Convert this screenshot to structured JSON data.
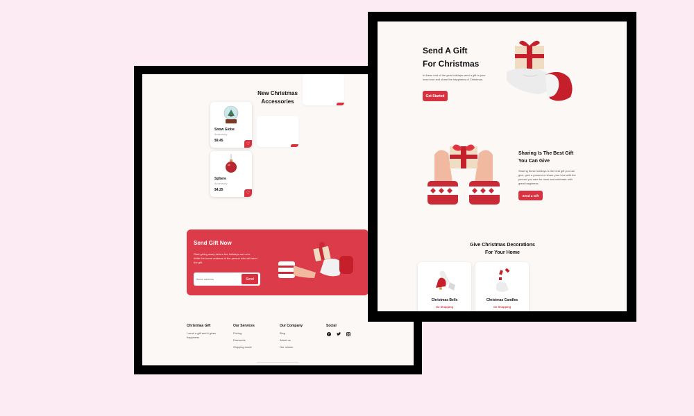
{
  "colors": {
    "background": "#fcebf3",
    "accent": "#d83240",
    "promo": "#dc3c4a"
  },
  "left": {
    "section_title_line1": "New Christmas",
    "section_title_line2": "Accessories",
    "products": [
      {
        "name": "Snow Globe",
        "category": "Accessory",
        "price": "$9.45",
        "icon": "snow-globe-icon"
      },
      {
        "name": "Sphere",
        "category": "Accessory",
        "price": "$4.25",
        "icon": "ornament-ball-icon"
      }
    ],
    "promo": {
      "title": "Send Gift Now",
      "text": "Start giving away before the holidays are over. Write the home address of the person who will send the gift.",
      "input_placeholder": "Home address",
      "send_label": "Send"
    },
    "footer": {
      "brand_title": "Christmas Gift",
      "brand_text": "I send a gift and it gives happiness",
      "services_title": "Our Services",
      "services": [
        "Pricing",
        "Discounts",
        "Shipping mode"
      ],
      "company_title": "Our Company",
      "company": [
        "Blog",
        "About us",
        "Our mision"
      ],
      "social_title": "Social",
      "social_icons": [
        "facebook-icon",
        "twitter-icon",
        "instagram-icon"
      ]
    }
  },
  "right": {
    "hero": {
      "title_line1": "Send A Gift",
      "title_line2": "For Christmas",
      "text": "In these end of the year holidays send a gift to your loved one and share the happiness of Christmas.",
      "button": "Get Started"
    },
    "share": {
      "title_line1": "Sharing Is The Best Gift",
      "title_line2": "You Can Give",
      "text": "Sharing these holidays is the best gift you can give, give a present or share your love with the person you care for most and celebrate with great happiness.",
      "button": "Send a Gift"
    },
    "decorations": {
      "title_line1": "Give Christmas Decorations",
      "title_line2": "For Your Home",
      "items": [
        {
          "name": "Christmas Bells",
          "link": "Go Shopping",
          "icon": "christmas-bell-icon"
        },
        {
          "name": "Christmas Candles",
          "link": "Go Shopping",
          "icon": "candy-cane-icon"
        }
      ]
    }
  }
}
